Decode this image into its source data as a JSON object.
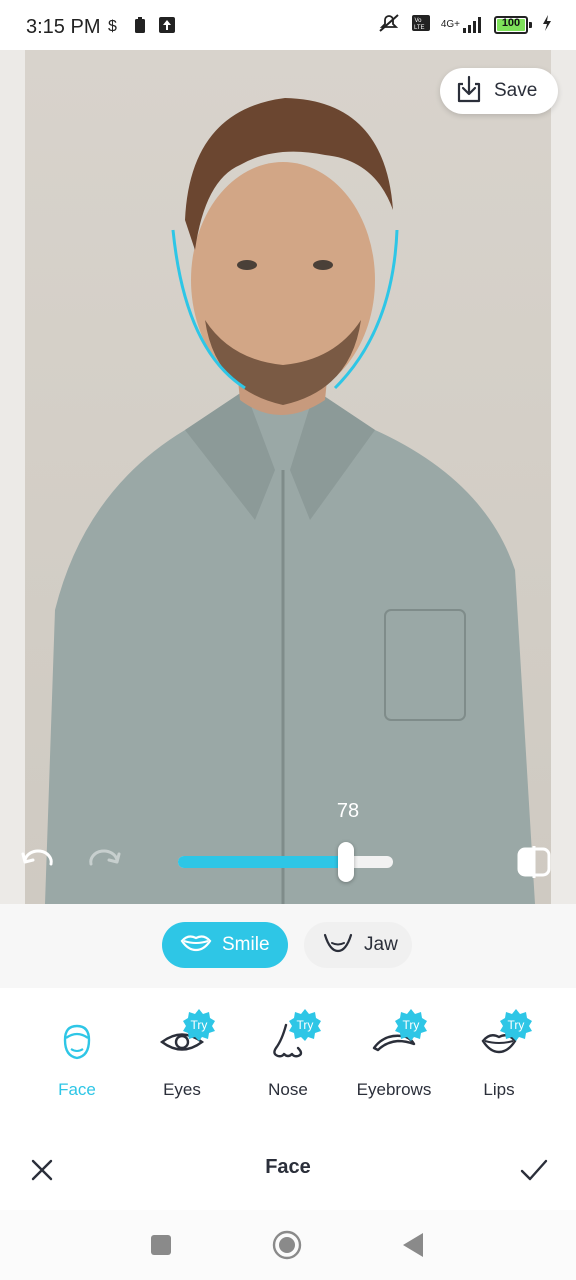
{
  "status_bar": {
    "time": "3:15 PM",
    "icons": [
      "dollar-icon",
      "battery-saver-icon",
      "upload-icon"
    ],
    "right_icons": [
      "mute-icon",
      "volte-icon",
      "signal-icon"
    ],
    "network": "4G+",
    "battery_level": "100"
  },
  "editor": {
    "save_label": "Save",
    "slider_value": "78",
    "slider_fraction": 0.78
  },
  "chips": [
    {
      "label": "Smile",
      "icon": "lips-icon",
      "active": true
    },
    {
      "label": "Jaw",
      "icon": "jaw-icon",
      "active": false
    }
  ],
  "tools": [
    {
      "label": "Face",
      "icon": "face-icon",
      "badge": "",
      "active": true
    },
    {
      "label": "Eyes",
      "icon": "eye-icon",
      "badge": "Try",
      "active": false
    },
    {
      "label": "Nose",
      "icon": "nose-icon",
      "badge": "Try",
      "active": false
    },
    {
      "label": "Eyebrows",
      "icon": "eyebrow-icon",
      "badge": "Try",
      "active": false
    },
    {
      "label": "Lips",
      "icon": "lips-icon",
      "badge": "Try",
      "active": false
    }
  ],
  "action_bar": {
    "title": "Face",
    "cancel_icon": "close-icon",
    "confirm_icon": "check-icon"
  },
  "colors": {
    "accent": "#2ec6e6",
    "text": "#2b2f3a",
    "badge": "#2ec6e6"
  }
}
